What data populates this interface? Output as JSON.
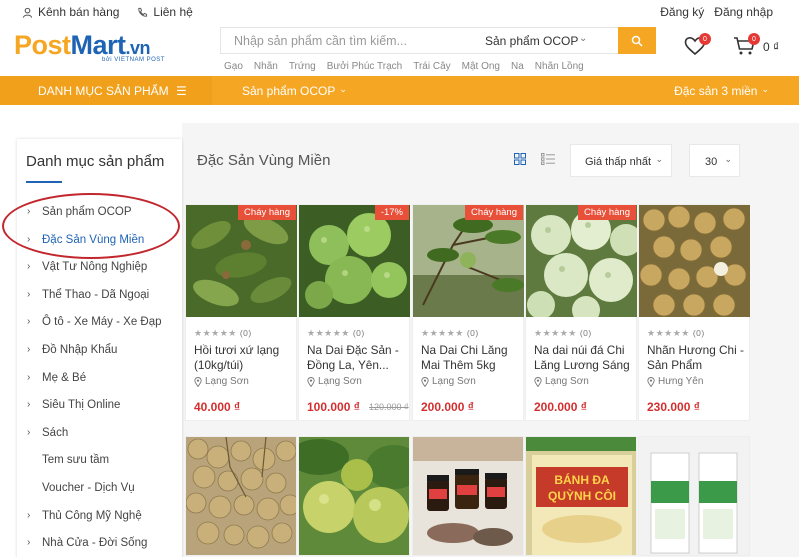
{
  "topbar": {
    "seller_channel": "Kênh bán hàng",
    "contact": "Liên hệ",
    "register": "Đăng ký",
    "login": "Đăng nhập"
  },
  "logo": {
    "post": "Post",
    "mart": "Mart",
    "vn": ".vn",
    "tagline": "bởi VIETNAM POST"
  },
  "search": {
    "placeholder": "Nhập sản phẩm cần tìm kiếm...",
    "category": "Sản phẩm OCOP",
    "suggestions": [
      "Gạo",
      "Nhãn",
      "Trứng",
      "Bưởi Phúc Trạch",
      "Trái Cây",
      "Mật Ong",
      "Na",
      "Nhãn Lồng"
    ]
  },
  "header_icons": {
    "wishlist_count": "0",
    "cart_count": "0",
    "cart_total": "0 ₫"
  },
  "navbar": {
    "category_label": "DANH MỤC SẢN PHẨM",
    "menu1": "Sản phẩm OCOP",
    "menu2": "Đặc sản 3 miền"
  },
  "sidebar": {
    "title": "Danh mục sản phẩm",
    "items": [
      {
        "label": "Sản phẩm OCOP",
        "chev": true
      },
      {
        "label": "Đặc Sản Vùng Miền",
        "chev": true,
        "active": true
      },
      {
        "label": "Vật Tư Nông Nghiệp",
        "chev": true
      },
      {
        "label": "Thể Thao - Dã Ngoại",
        "chev": true
      },
      {
        "label": "Ô tô - Xe Máy - Xe Đạp",
        "chev": true
      },
      {
        "label": "Đồ Nhập Khẩu",
        "chev": true
      },
      {
        "label": "Mẹ & Bé",
        "chev": true
      },
      {
        "label": "Siêu Thị Online",
        "chev": true
      },
      {
        "label": "Sách",
        "chev": true
      },
      {
        "label": "Tem sưu tầm",
        "chev": false
      },
      {
        "label": "Voucher - Dịch Vụ",
        "chev": false
      },
      {
        "label": "Thủ Công Mỹ Nghệ",
        "chev": true
      },
      {
        "label": "Nhà Cửa - Đời Sống",
        "chev": true
      }
    ]
  },
  "content": {
    "title": "Đặc Sản Vùng Miền",
    "sort_label": "Giá thấp nhất",
    "per_page": "30"
  },
  "products": [
    {
      "tag": "Cháy hàng",
      "stars": "★★★★★",
      "reviews": "(0)",
      "name": "Hồi tươi xứ lạng (10kg/túi)",
      "location": "Lạng Sơn",
      "price": "40.000 ₫",
      "old_price": ""
    },
    {
      "tag": "-17%",
      "stars": "★★★★★",
      "reviews": "(0)",
      "name": "Na Dai Đặc Sản - Đồng La, Yên...",
      "location": "Lạng Sơn",
      "price": "100.000 ₫",
      "old_price": "120.000 ₫"
    },
    {
      "tag": "Cháy hàng",
      "stars": "★★★★★",
      "reviews": "(0)",
      "name": "Na Dai Chi Lăng Mai Thêm 5kg",
      "location": "Lạng Sơn",
      "price": "200.000 ₫",
      "old_price": ""
    },
    {
      "tag": "Cháy hàng",
      "stars": "★★★★★",
      "reviews": "(0)",
      "name": "Na dai núi đá Chi Lăng Lương Sáng",
      "location": "Lạng Sơn",
      "price": "200.000 ₫",
      "old_price": ""
    },
    {
      "tag": "",
      "stars": "★★★★★",
      "reviews": "(0)",
      "name": "Nhãn Hương Chi - Sản Phẩm Vietga...",
      "location": "Hưng Yên",
      "price": "230.000 ₫",
      "old_price": ""
    }
  ],
  "row2_images": [
    "longan-bunch-image",
    "green-pomelo-image",
    "honey-jars-image",
    "banh-da-package-image",
    "white-package-image"
  ],
  "package_text": {
    "line1": "BÁNH ĐA",
    "line2": "QUỲNH CÔI"
  },
  "colors": {
    "accent": "#f5a623",
    "brand_blue": "#1f64b4",
    "price_red": "#d32f2f",
    "tag_red": "#e8503a",
    "circle": "#c1272d"
  }
}
